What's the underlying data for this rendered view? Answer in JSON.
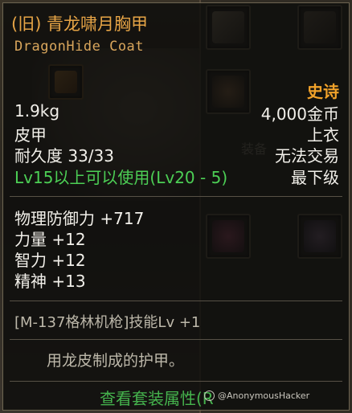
{
  "item": {
    "name": "(旧) 青龙啸月胸甲",
    "name_en": "DragonHide Coat",
    "rarity": "史诗",
    "weight": "1.9kg",
    "price": "4,000金币",
    "material": "皮甲",
    "slot": "上衣",
    "durability_label": "耐久度 33/33",
    "trade": "无法交易",
    "level_req": "Lv15以上可以使用(Lv20 - 5)",
    "grade": "最下级",
    "stats": [
      "物理防御力 +717",
      "力量 +12",
      "智力 +12",
      "精神 +13"
    ],
    "skill": "[M-137格林机枪]技能Lv +1",
    "description": "用龙皮制成的护甲。",
    "set_button": "查看套装属性(R"
  },
  "background": {
    "equip_label": "装备"
  },
  "watermark": {
    "text": "@AnonymousHacker"
  },
  "colors": {
    "title": "#e6a446",
    "rarity": "#f1a22a",
    "green": "#4ccf55",
    "text": "#f2f0ea"
  }
}
